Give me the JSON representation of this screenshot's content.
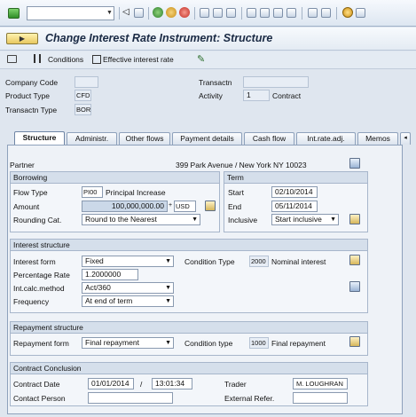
{
  "title": "Change Interest Rate Instrument: Structure",
  "toolbar": {
    "conditions": "Conditions",
    "effective_interest_rate": "Effective interest rate"
  },
  "header": {
    "company_code_label": "Company Code",
    "product_type_label": "Product Type",
    "product_type_value": "CFD",
    "transactn_type_label": "Transactn Type",
    "transactn_type_value": "BOR",
    "transactn_label": "Transactn",
    "activity_label": "Activity",
    "activity_value": "1",
    "activity_text": "Contract"
  },
  "tabs": [
    "Structure",
    "Administr.",
    "Other flows",
    "Payment details",
    "Cash flow",
    "Int.rate.adj.",
    "Memos"
  ],
  "partner": {
    "label": "Partner",
    "address": "399 Park Avenue / New York NY 10023"
  },
  "borrowing": {
    "title": "Borrowing",
    "flow_type_label": "Flow Type",
    "flow_type_value": "PI00",
    "flow_type_text": "Principal Increase",
    "amount_label": "Amount",
    "amount_value": "100,000,000.00",
    "currency": "USD",
    "rounding_label": "Rounding Cat.",
    "rounding_value": "Round to the Nearest"
  },
  "term": {
    "title": "Term",
    "start_label": "Start",
    "start_value": "02/10/2014",
    "end_label": "End",
    "end_value": "05/11/2014",
    "inclusive_label": "Inclusive",
    "inclusive_value": "Start inclusive"
  },
  "interest": {
    "title": "Interest structure",
    "form_label": "Interest form",
    "form_value": "Fixed",
    "cond_type_label": "Condition Type",
    "cond_type_value": "2000",
    "cond_type_text": "Nominal interest",
    "pct_label": "Percentage Rate",
    "pct_value": "1.2000000",
    "calc_label": "Int.calc.method",
    "calc_value": "Act/360",
    "freq_label": "Frequency",
    "freq_value": "At end of term"
  },
  "repayment": {
    "title": "Repayment structure",
    "form_label": "Repayment form",
    "form_value": "Final repayment",
    "cond_type_label": "Condition type",
    "cond_type_value": "1000",
    "cond_type_text": "Final repayment"
  },
  "conclusion": {
    "title": "Contract Conclusion",
    "date_label": "Contract Date",
    "date_value": "01/01/2014",
    "time_value": "13:01:34",
    "trader_label": "Trader",
    "trader_value": "M. LOUGHRAN",
    "contact_label": "Contact Person",
    "ext_ref_label": "External Refer."
  }
}
